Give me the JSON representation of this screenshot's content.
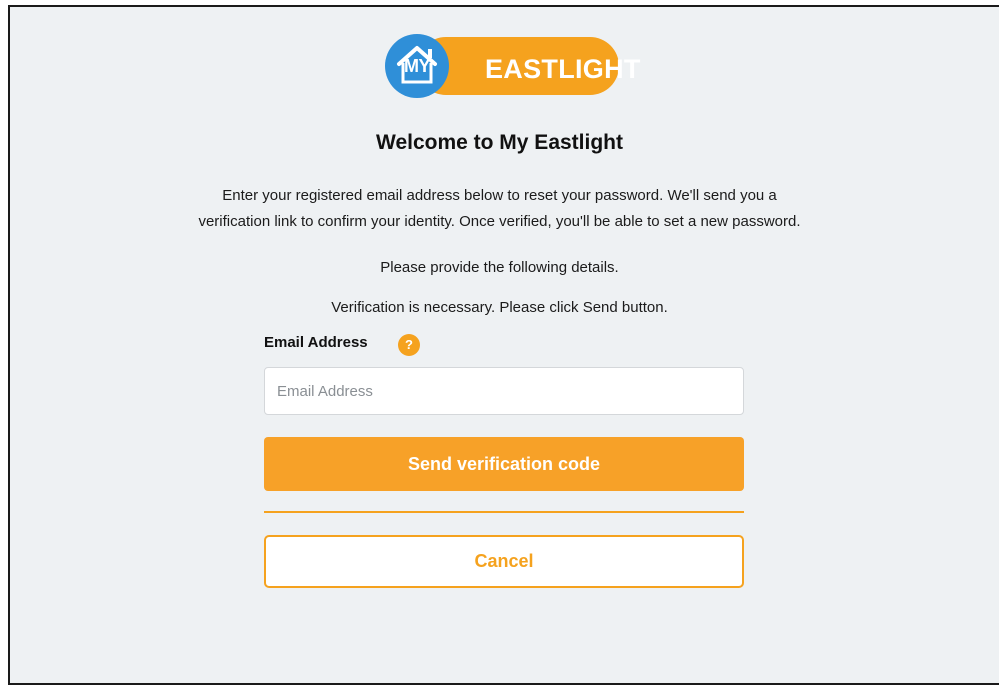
{
  "brand": {
    "logo_prefix": "MY",
    "logo_name": "EASTLIGHT",
    "colors": {
      "primary": "#f5a21e",
      "logo_blue": "#2f8fd8",
      "background": "#eef1f3"
    }
  },
  "header": {
    "title": "Welcome to My Eastlight"
  },
  "description": {
    "line1": "Enter your registered email address below to reset your password. We'll send you a",
    "line2": "verification link to confirm your identity. Once verified, you'll be able to set a new password."
  },
  "info": {
    "details_prompt": "Please provide the following details.",
    "verification_note": "Verification is necessary. Please click Send button."
  },
  "form": {
    "email_label": "Email Address",
    "help_icon": "question-mark-icon",
    "help_glyph": "?",
    "email_value": "",
    "email_placeholder": "Email Address"
  },
  "actions": {
    "send_label": "Send verification code",
    "cancel_label": "Cancel"
  }
}
